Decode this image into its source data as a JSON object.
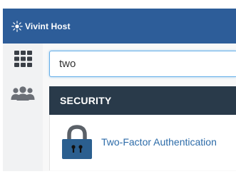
{
  "header": {
    "brand_name": "Vivint Host",
    "brand_icon": "sun-burst-icon",
    "background_color": "#2d5d99"
  },
  "sidebar": {
    "items": [
      {
        "icon": "apps-grid-icon"
      },
      {
        "icon": "users-icon"
      }
    ]
  },
  "search": {
    "value": "two"
  },
  "results": {
    "section_title": "SECURITY",
    "items": [
      {
        "label": "Two-Factor Authentication",
        "icon": "padlock-icon"
      }
    ]
  },
  "colors": {
    "accent": "#2c6ba8",
    "section_header": "#293a4a",
    "sidebar": "#f1f2f3"
  }
}
